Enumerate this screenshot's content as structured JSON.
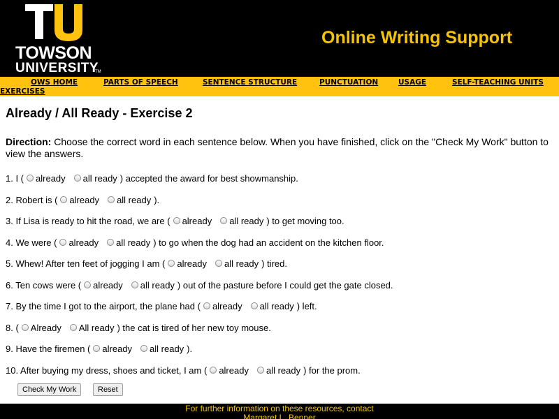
{
  "header": {
    "logo_letters": "TU",
    "logo_name": "TOWSON",
    "logo_sub": "UNIVERSITY",
    "logo_tm": "TM",
    "site_title": "Online Writing Support",
    "brand_gold": "#ffc20e",
    "brand_black": "#000000"
  },
  "nav": {
    "items": [
      {
        "label": "OWS HOME"
      },
      {
        "label": "PARTS OF SPEECH"
      },
      {
        "label": "SENTENCE STRUCTURE"
      },
      {
        "label": "PUNCTUATION"
      },
      {
        "label": "USAGE"
      },
      {
        "label": "SELF-TEACHING UNITS"
      },
      {
        "label": "EXERCISES"
      }
    ]
  },
  "page": {
    "title": "Already / All Ready - Exercise 2",
    "direction_label": "Direction:",
    "direction_text": " Choose the correct word in each sentence below. When you have finished, click on the \"Check My Work\" button to view the answers."
  },
  "questions": [
    {
      "prefix": "1. I (",
      "a": "already",
      "b": "all ready",
      "suffix": ") accepted the award for best showmanship."
    },
    {
      "prefix": "2. Robert is (",
      "a": "already",
      "b": "all ready",
      "suffix": ")."
    },
    {
      "prefix": "3. If Lisa is ready to hit the road, we are (",
      "a": "already",
      "b": "all ready",
      "suffix": ") to get moving too."
    },
    {
      "prefix": "4. We were (",
      "a": "already",
      "b": "all ready",
      "suffix": ") to go when the dog had an accident on the kitchen floor."
    },
    {
      "prefix": "5. Whew! After ten feet of jogging I am (",
      "a": "already",
      "b": "all ready",
      "suffix": ") tired."
    },
    {
      "prefix": "6. Ten cows were (",
      "a": "already",
      "b": "all ready",
      "suffix": ") out of the pasture before I could get the gate closed."
    },
    {
      "prefix": "7. By the time I got to the airport, the plane had (",
      "a": "already",
      "b": "all ready",
      "suffix": ") left."
    },
    {
      "prefix": "8. (",
      "a": "Already",
      "b": "All ready",
      "suffix": ") the cat is tired of her new toy mouse."
    },
    {
      "prefix": "9. Have the firemen (",
      "a": "already",
      "b": "all ready",
      "suffix": ")."
    },
    {
      "prefix": "10. After buying my dress, shoes and ticket, I am (",
      "a": "already",
      "b": "all ready",
      "suffix": ") for the prom."
    }
  ],
  "buttons": {
    "check": "Check My Work",
    "reset": "Reset"
  },
  "footer": {
    "line1": "For further information on these resources, contact",
    "line2": "Margaret L. Benner"
  }
}
